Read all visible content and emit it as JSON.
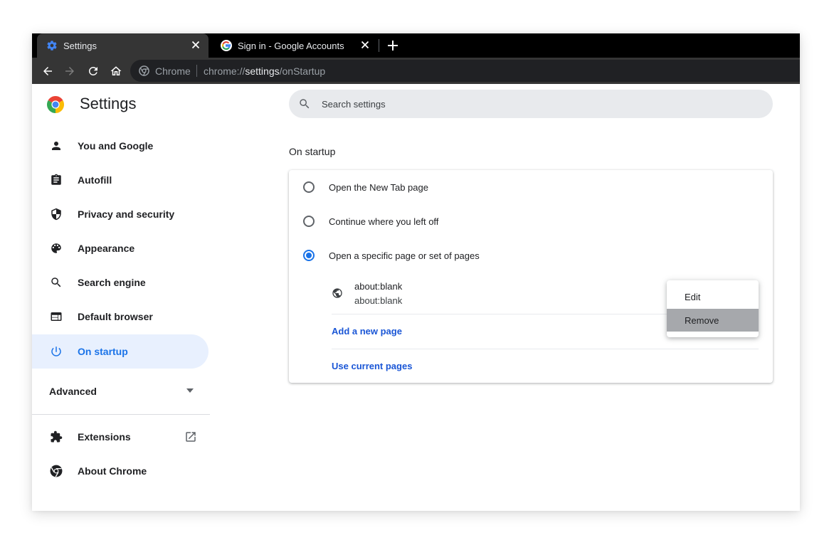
{
  "browser": {
    "tabs": [
      {
        "title": "Settings",
        "active": true,
        "icon": "gear-icon"
      },
      {
        "title": "Sign in - Google Accounts",
        "active": false,
        "icon": "google-g-icon"
      }
    ],
    "omnibox": {
      "chip": "Chrome",
      "url_scheme": "chrome://",
      "url_host": "settings",
      "url_path": "/onStartup"
    }
  },
  "sidebar": {
    "app_title": "Settings",
    "items": [
      {
        "label": "You and Google",
        "icon": "person-icon"
      },
      {
        "label": "Autofill",
        "icon": "clipboard-icon"
      },
      {
        "label": "Privacy and security",
        "icon": "shield-icon"
      },
      {
        "label": "Appearance",
        "icon": "palette-icon"
      },
      {
        "label": "Search engine",
        "icon": "search-icon"
      },
      {
        "label": "Default browser",
        "icon": "browser-window-icon"
      },
      {
        "label": "On startup",
        "icon": "power-icon",
        "selected": true
      }
    ],
    "advanced_label": "Advanced",
    "extensions_label": "Extensions",
    "about_label": "About Chrome"
  },
  "search": {
    "placeholder": "Search settings"
  },
  "main": {
    "section_title": "On startup",
    "options": [
      {
        "label": "Open the New Tab page",
        "checked": false
      },
      {
        "label": "Continue where you left off",
        "checked": false
      },
      {
        "label": "Open a specific page or set of pages",
        "checked": true
      }
    ],
    "pages": [
      {
        "title": "about:blank",
        "url": "about:blank"
      }
    ],
    "add_page_label": "Add a new page",
    "use_current_label": "Use current pages"
  },
  "context_menu": {
    "items": [
      {
        "label": "Edit"
      },
      {
        "label": "Remove",
        "highlighted": true
      }
    ]
  },
  "colors": {
    "accent": "#1a73e8",
    "selected_bg": "#e8f0fe",
    "link": "#1a56d6",
    "titlebar": "#000000",
    "toolbar": "#353535"
  }
}
